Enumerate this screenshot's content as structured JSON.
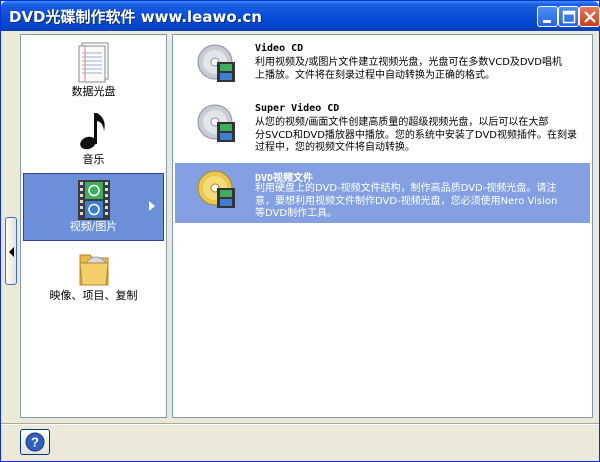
{
  "window": {
    "title": "DVD光碟制作软件 www.leawo.cn"
  },
  "categories": [
    {
      "label": "数据光盘",
      "icon": "document-icon",
      "selected": false
    },
    {
      "label": "音乐",
      "icon": "music-note-icon",
      "selected": false
    },
    {
      "label": "视频/图片",
      "icon": "film-strip-icon",
      "selected": true
    },
    {
      "label": "映像、项目、复制",
      "icon": "folder-disc-icon",
      "selected": false
    }
  ],
  "tasks": [
    {
      "title": "Video CD",
      "line1": "利用视频及/或图片文件建立视频光盘，光盘可在多数VCD及DVD唱机",
      "line2": "上播放。文件将在刻录过程中自动转换为正确的格式。",
      "line3": "",
      "selected": false
    },
    {
      "title": "Super Video CD",
      "line1": "从您的视频/画面文件创建高质量的超级视频光盘，以后可以在大部",
      "line2": "分SVCD和DVD播放器中播放。您的系统中安装了DVD视频插件。在刻录",
      "line3": "过程中，您的视频文件将自动转换。",
      "selected": false
    },
    {
      "title": "DVD视频文件",
      "line1": "利用硬盘上的DVD-视频文件结构，制作高品质DVD-视频光盘。请注",
      "line2": "意，要想利用视频文件制作DVD-视频光盘，您必须使用Nero Vision",
      "line3": "等DVD制作工具。",
      "selected": true
    }
  ],
  "colors": {
    "selection": "#6b8fd8",
    "task_selection": "#84a0e3",
    "titlebar": "#0a4fd8"
  }
}
